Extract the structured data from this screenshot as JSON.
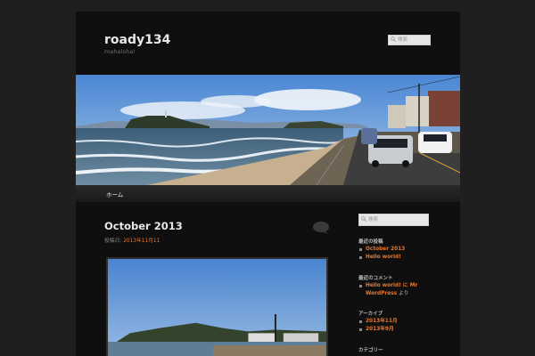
{
  "site": {
    "title": "roady134",
    "description": "mahaloha!"
  },
  "search": {
    "header_placeholder": "検索",
    "sidebar_placeholder": "検索"
  },
  "nav": {
    "items": [
      {
        "label": "ホーム"
      }
    ]
  },
  "post": {
    "title": "October 2013",
    "meta_prefix": "投稿日:",
    "date": "2013年11月11"
  },
  "sidebar": {
    "recent_posts": {
      "title": "最近の投稿",
      "items": [
        "October 2013",
        "Hello world!"
      ]
    },
    "recent_comments": {
      "title": "最近のコメント",
      "line1": "Hello world! に Mr",
      "line2_link": "WordPress",
      "line2_rest": " より"
    },
    "archives": {
      "title": "アーカイブ",
      "items": [
        "2013年11月",
        "2013年9月"
      ]
    },
    "categories": {
      "title": "カテゴリー"
    }
  },
  "colors": {
    "background": "#1f1f1f",
    "page": "#0f0f0f",
    "accent_link": "#e7782f",
    "title_text": "#e8e8e8"
  }
}
